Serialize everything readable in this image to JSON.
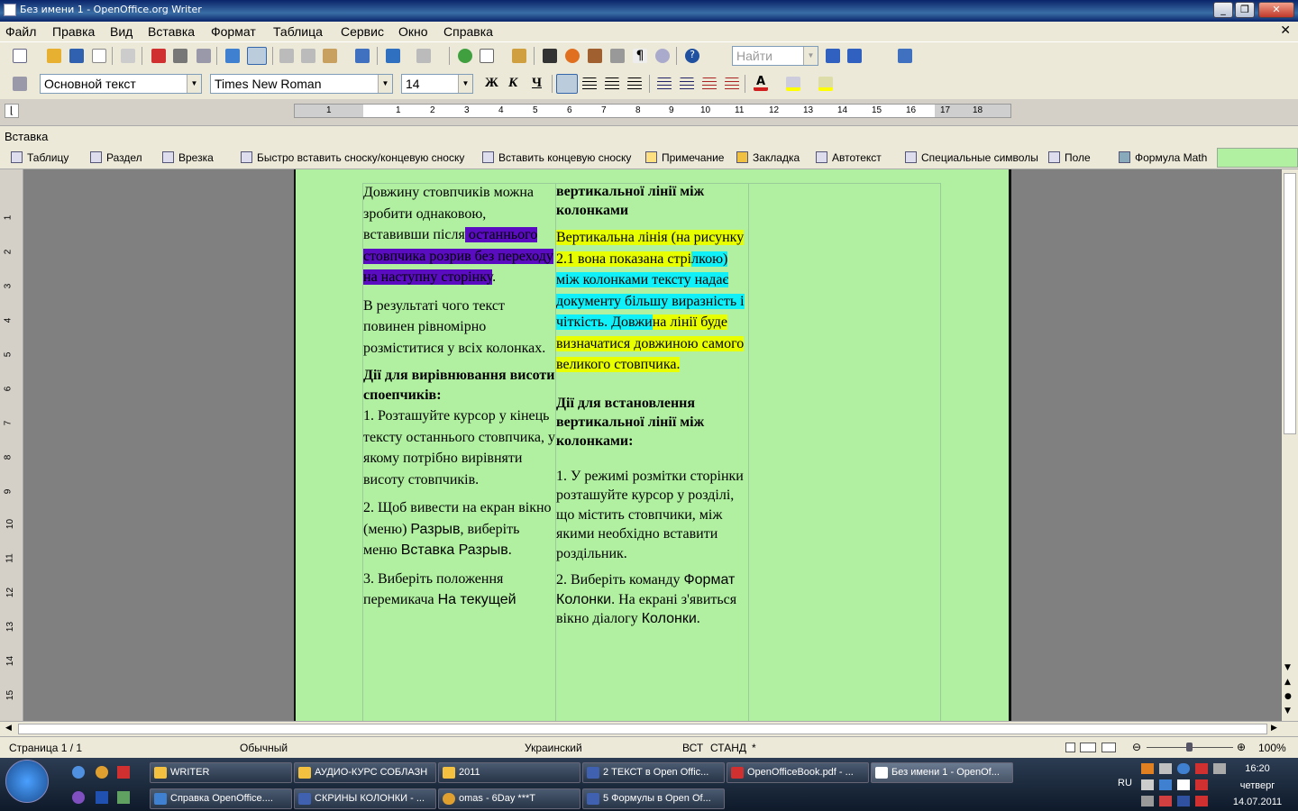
{
  "window": {
    "title": "Без имени 1 - OpenOffice.org Writer"
  },
  "menu": [
    "Файл",
    "Правка",
    "Вид",
    "Вставка",
    "Формат",
    "Таблица",
    "Сервис",
    "Окно",
    "Справка"
  ],
  "find": {
    "placeholder": "Найти"
  },
  "format": {
    "style": "Основной текст",
    "font": "Times New Roman",
    "size": "14",
    "bold": "Ж",
    "italic": "К",
    "underline": "Ч"
  },
  "ruler": {
    "ticks": [
      "1",
      "1",
      "2",
      "3",
      "4",
      "5",
      "6",
      "7",
      "8",
      "9",
      "10",
      "11",
      "12",
      "13",
      "14",
      "15",
      "16",
      "17",
      "18"
    ]
  },
  "vruler": {
    "ticks": [
      "1",
      "2",
      "3",
      "4",
      "5",
      "6",
      "7",
      "8",
      "9",
      "10",
      "11",
      "12",
      "13",
      "14",
      "15"
    ]
  },
  "insert_toolbar": {
    "title": "Вставка",
    "items": [
      "Таблицу",
      "Раздел",
      "Врезка",
      "Быстро вставить сноску/концевую сноску",
      "Вставить концевую сноску",
      "Примечание",
      "Закладка",
      "Автотекст",
      "Специальные символы",
      "Поле",
      "Формула Math"
    ]
  },
  "doc": {
    "col1": {
      "p1_a": "Довжину стовпчиків можна зробити однаковою, вставивши після",
      "p1_hl": " останнього стовпчика розрив без переходу на наступну сторінку",
      "p1_end": ".",
      "p2": "В результаті чого текст повинен рівномірно розміститися у всіх колонках.",
      "h1": "Дії для вирівнювання висоти споепчиків:",
      "s1": "1. ",
      "s1b": "Розташуйте курсор у кінець тексту останнього стовпчика, у якому потрібно вирівняти висоту стовпчиків.",
      "s2": "2. ",
      "s2b": "Щоб вивести на екран вікно (меню) ",
      "s2c": "Разрыв",
      "s2d": ", виберіть меню ",
      "s2e": "Вставка  Разрыв",
      "s2f": ".",
      "s3": "3. ",
      "s3b": "Виберіть положення перемикача ",
      "s3c": "На текущей"
    },
    "col2": {
      "h0": "вертикальної лінії між колонками",
      "p1_y1": "Вертикальна лінія (на рисунку 2.1 вона показана стрі",
      "p1_c": "лкою) між колонками тексту надає документу більшу виразність і чіткість. Довжи",
      "p1_y2": "на лінії буде визначатися довжиною самого великого стовпчика.",
      "h1": "Дії для встановлення вертикальної лінії між колонками:",
      "s1": "1. ",
      "s1b": "У режимі розмітки сторінки розташуйте курсор у розділі, що містить стовпчики, між якими необхідно вставити роздільник.",
      "s2": "2. ",
      "s2b": "Виберіть команду ",
      "s2c": "Формат  Колонки",
      "s2d": ". На екрані з'явиться вікно діалогу ",
      "s2e": "Колонки",
      "s2f": "."
    }
  },
  "status": {
    "page": "Страница  1 / 1",
    "style": "Обычный",
    "lang": "Украинский",
    "ins": "ВСТ",
    "std": "СТАНД",
    "star": "*",
    "zoom": "100%"
  },
  "taskbar": {
    "row1": [
      "WRITER",
      "АУДИО-КУРС СОБЛАЗН",
      "2011",
      "2 ТЕКСТ в Open Offic...",
      "OpenOfficeBook.pdf - ...",
      "Без имени 1 - OpenOf..."
    ],
    "row2": [
      "Справка OpenOffice....",
      "СКРИНЫ КОЛОНКИ - ...",
      "omas - 6Day ***T",
      "5 Формулы в Open Of..."
    ],
    "lang": "RU",
    "time": "16:20",
    "day": "четверг",
    "date": "14.07.2011"
  },
  "colors": {
    "page": "#b0f0a0",
    "hl_purple": "#5a0cc0",
    "hl_cyan": "#10f0f8",
    "hl_yellow": "#e8ff00"
  }
}
